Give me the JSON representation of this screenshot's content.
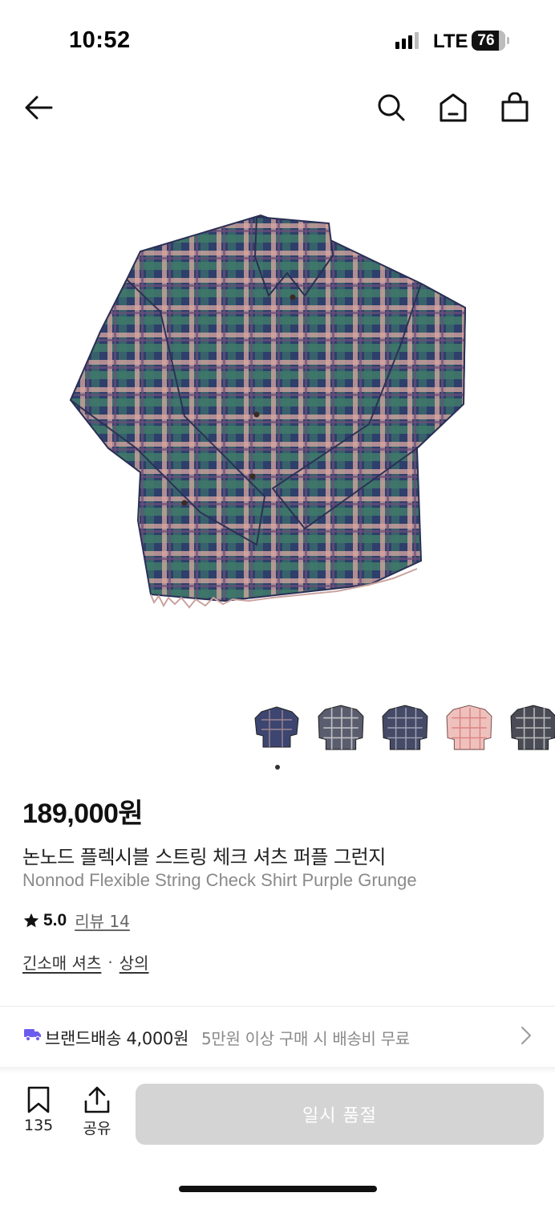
{
  "status_bar": {
    "time": "10:52",
    "network": "LTE",
    "battery": "76"
  },
  "nav": {
    "icons": [
      "back-arrow-icon",
      "search-icon",
      "home-icon",
      "shopping-bag-icon"
    ]
  },
  "product": {
    "image_icon": "plaid-shirt",
    "thumbnails": [
      {
        "icon": "plaid-shirt",
        "color": "#3c4670"
      },
      {
        "icon": "plaid-shirt",
        "color": "#5a5d6e"
      },
      {
        "icon": "plaid-shirt",
        "color": "#454a66"
      },
      {
        "icon": "plaid-shirt",
        "color": "#d99a9a"
      },
      {
        "icon": "plaid-shirt",
        "color": "#4a4c55"
      }
    ],
    "price": "189,000원",
    "name_ko": "논노드 플렉시블 스트링 체크 셔츠 퍼플 그런지",
    "name_en": "Nonnod Flexible String Check Shirt Purple Grunge",
    "rating": "5.0",
    "review_label": "리뷰 14",
    "category_primary": "긴소매 셔츠",
    "category_separator": "·",
    "category_secondary": "상의"
  },
  "shipping": {
    "label": "브랜드배송 4,000원",
    "note": "5만원 이상 구매 시 배송비 무료",
    "icon_color": "#6b5cf0"
  },
  "bottom_bar": {
    "bookmark_count": "135",
    "share_label": "공유",
    "cta_label": "일시 품절"
  }
}
